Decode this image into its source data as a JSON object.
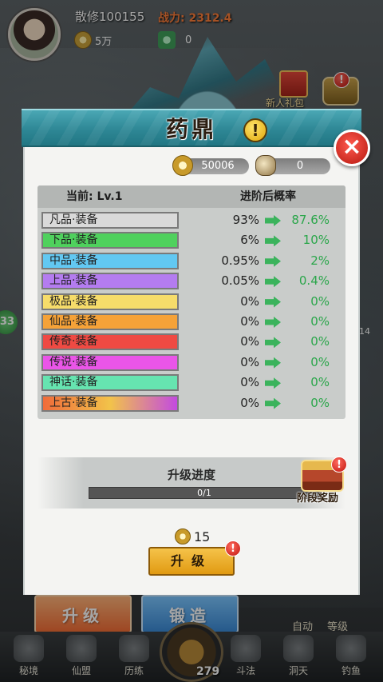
{
  "player": {
    "name": "散修100155",
    "power_label": "战力: 2312.4",
    "gold": "5万",
    "jade": "0"
  },
  "event": {
    "gift_label": "新人礼包"
  },
  "side": {
    "left_badge": "33",
    "right_num": "14"
  },
  "dialog": {
    "title": "药鼎",
    "info_icon": "!",
    "close_icon": "×",
    "currency": {
      "gold_value": "50006",
      "ore_value": "0"
    },
    "table": {
      "head_current": "当前: Lv.1",
      "head_after": "进阶后概率",
      "rows": [
        {
          "tier": "凡品·装备",
          "current": "93%",
          "after": "87.6%",
          "color": "#d9d9d9"
        },
        {
          "tier": "下品·装备",
          "current": "6%",
          "after": "10%",
          "color": "#4fd15d"
        },
        {
          "tier": "中品·装备",
          "current": "0.95%",
          "after": "2%",
          "color": "#62c8f2"
        },
        {
          "tier": "上品·装备",
          "current": "0.05%",
          "after": "0.4%",
          "color": "#b47cf0"
        },
        {
          "tier": "极品·装备",
          "current": "0%",
          "after": "0%",
          "color": "#f6dc6a"
        },
        {
          "tier": "仙品·装备",
          "current": "0%",
          "after": "0%",
          "color": "#f5a238"
        },
        {
          "tier": "传奇·装备",
          "current": "0%",
          "after": "0%",
          "color": "#ef4a43"
        },
        {
          "tier": "传说·装备",
          "current": "0%",
          "after": "0%",
          "color": "#ea55e8"
        },
        {
          "tier": "神话·装备",
          "current": "0%",
          "after": "0%",
          "color": "#66e4b0"
        },
        {
          "tier": "上古·装备",
          "current": "0%",
          "after": "0%",
          "color": "gradient"
        }
      ]
    },
    "progress": {
      "title": "升级进度",
      "text": "0/1",
      "fraction": 0,
      "reward_label": "阶段奖励"
    },
    "cost": "15",
    "upgrade_button": "升级",
    "badge": "!"
  },
  "bottom": {
    "upgrade_tab": "升级",
    "forge_tab": "锻造",
    "auto": "自动",
    "rank": "等级",
    "nav": [
      "秘境",
      "仙盟",
      "历练",
      "斗法",
      "洞天",
      "钓鱼"
    ],
    "center_num": "279"
  }
}
